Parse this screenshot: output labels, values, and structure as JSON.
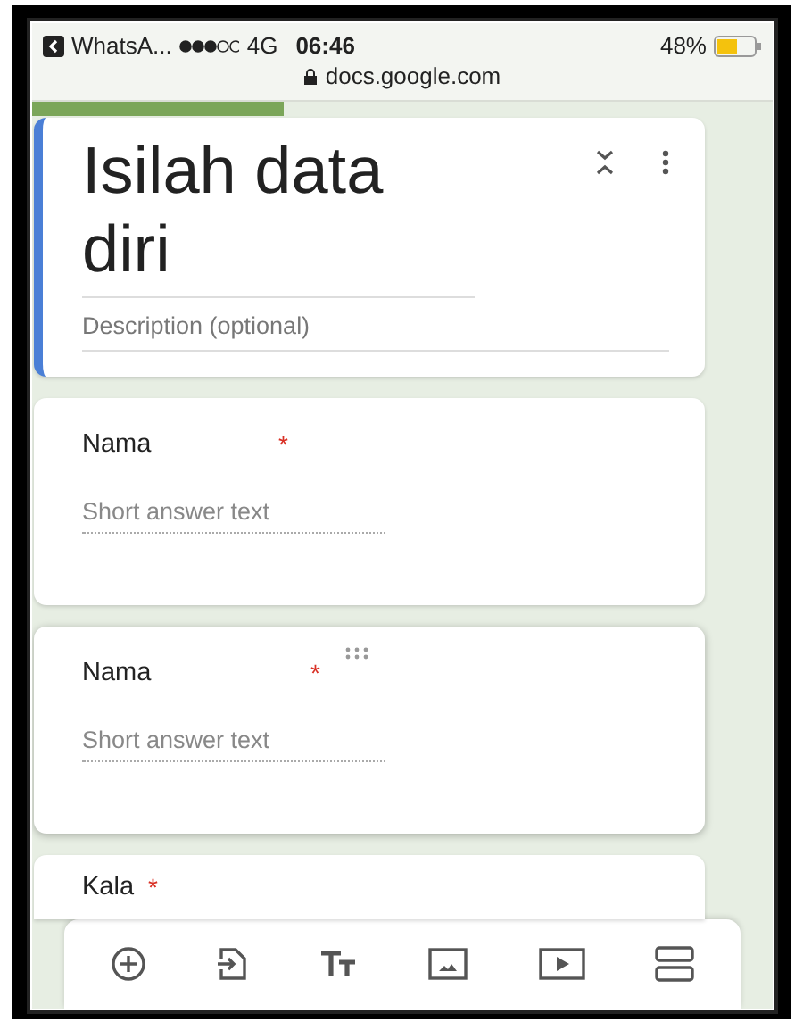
{
  "status_bar": {
    "back_label": "WhatsA...",
    "network": "4G",
    "time": "06:46",
    "battery": "48%"
  },
  "address_bar": {
    "url": "docs.google.com"
  },
  "progress": {
    "level": 0.34
  },
  "form_header": {
    "title": "Isilah data diri",
    "description_placeholder": "Description (optional)"
  },
  "questions": [
    {
      "title": "Nama",
      "required_mark": "*",
      "placeholder": "Short answer text",
      "selected": false
    },
    {
      "title": "Nama",
      "required_mark": "*",
      "placeholder": "Short answer text",
      "selected": true
    },
    {
      "title": "Kala",
      "required_mark": "*",
      "selected": false
    }
  ]
}
